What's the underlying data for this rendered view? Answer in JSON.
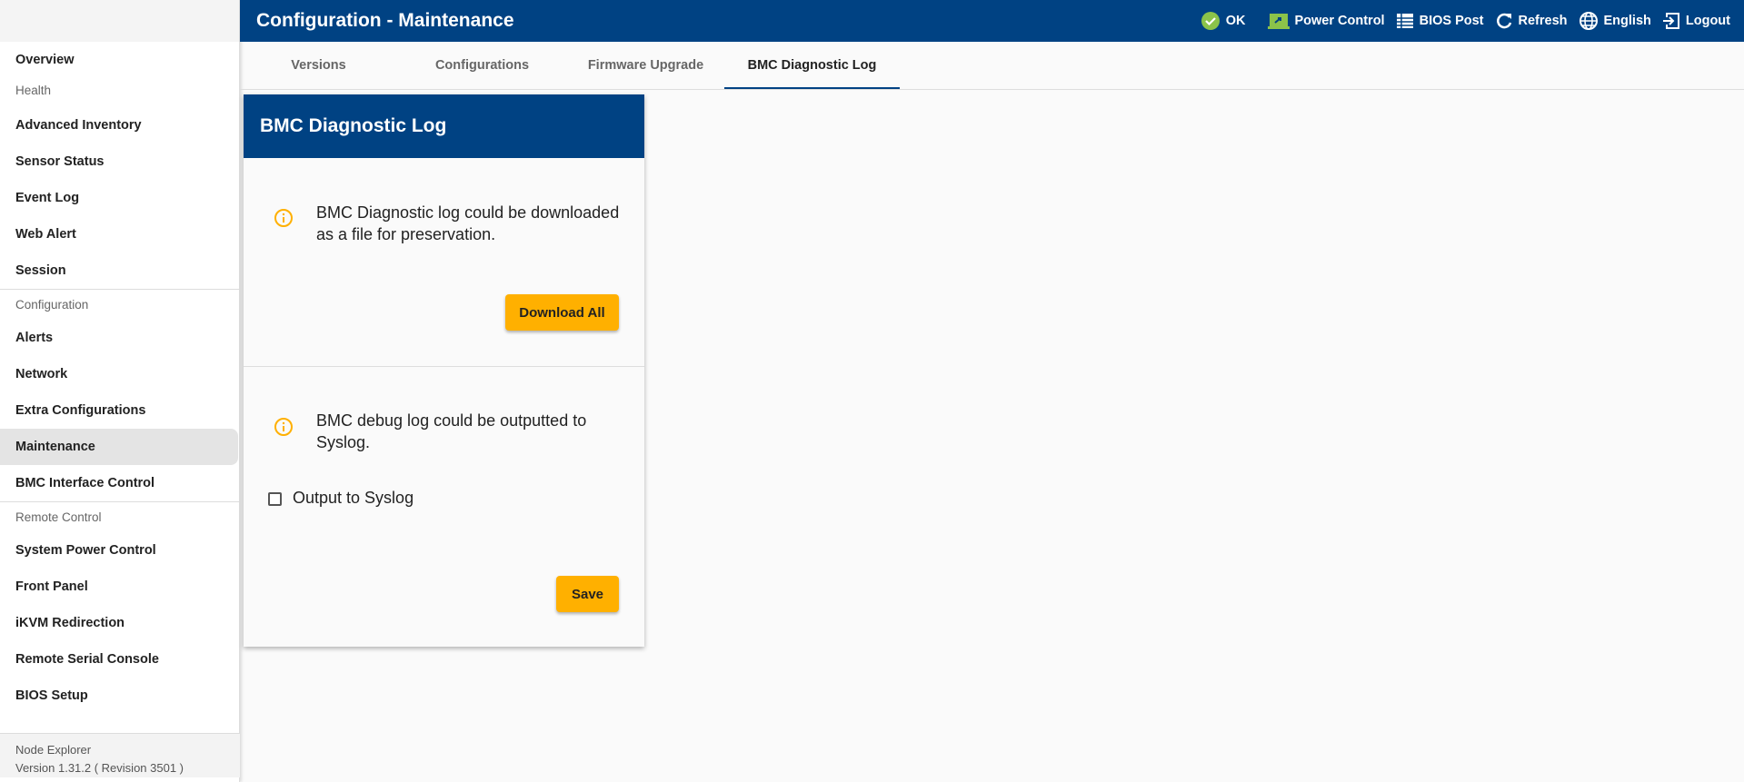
{
  "header": {
    "title": "Configuration - Maintenance",
    "status": "OK",
    "power": "Power Control",
    "bios": "BIOS Post",
    "refresh": "Refresh",
    "language": "English",
    "logout": "Logout"
  },
  "tabs": [
    "Versions",
    "Configurations",
    "Firmware Upgrade",
    "BMC Diagnostic Log"
  ],
  "sidebar": {
    "overview": "Overview",
    "health": {
      "label": "Health",
      "items": [
        "Advanced Inventory",
        "Sensor Status",
        "Event Log",
        "Web Alert",
        "Session"
      ]
    },
    "configuration": {
      "label": "Configuration",
      "items": [
        "Alerts",
        "Network",
        "Extra Configurations",
        "Maintenance",
        "BMC Interface Control"
      ]
    },
    "remote": {
      "label": "Remote Control",
      "items": [
        "System Power Control",
        "Front Panel",
        "iKVM Redirection",
        "Remote Serial Console",
        "BIOS Setup"
      ]
    },
    "footer": {
      "product": "Node Explorer",
      "version": "Version 1.31.2 ( Revision 3501 )"
    }
  },
  "card": {
    "title": "BMC Diagnostic Log",
    "download_msg": "BMC Diagnostic log could be downloaded as a file for preservation.",
    "download_btn": "Download All",
    "syslog_msg": "BMC debug log could be outputted to Syslog.",
    "syslog_label": "Output to Syslog",
    "syslog_checked": false,
    "save_btn": "Save"
  },
  "colors": {
    "primary": "#004283",
    "accent": "#ffb000",
    "ok": "#8bc34a"
  }
}
